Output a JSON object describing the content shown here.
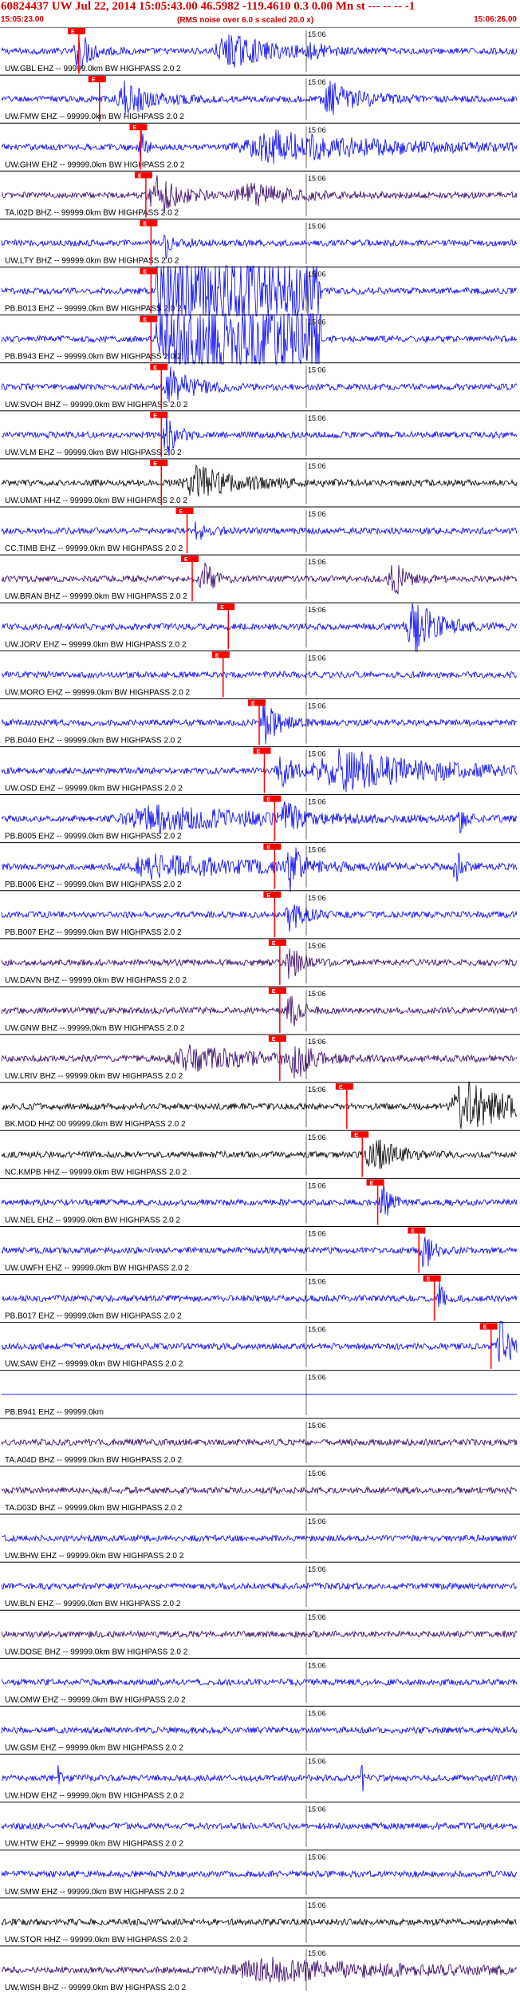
{
  "header": {
    "title": "60824437 UW Jul 22, 2014 15:05:43.00   46.5982 -119.4610  0.3 0.00 Mn st --- -- --   -1",
    "start_time": "15:05:23.00",
    "rms_note": "(RMS noise over 6.0 s scaled 20.0 x)",
    "end_time": "15:06:26.00"
  },
  "chart_data": {
    "type": "line",
    "title": "60824437 UW Jul 22, 2014 15:05:43.00   46.5982 -119.4610  0.3 0.00 Mn st --- -- --   -1",
    "subtitle": "(RMS noise over 6.0 s scaled 20.0 x)",
    "x_range": [
      "15:05:23.00",
      "15:06:26.00"
    ],
    "x_tick_label": "15:06",
    "colors": {
      "blue": "#0000ff",
      "black": "#000000",
      "purple": "#330066",
      "pick": "#ff0000",
      "grid": "#000000"
    },
    "traces": [
      {
        "label": "UW.GBL EHZ -- 99999.0km BW  HIGHPASS  2.0  2",
        "color": "blue",
        "pick": "E",
        "pick_frac": 0.15,
        "events": [
          {
            "at": 0.15,
            "w": 0.03,
            "a": 0.75
          },
          {
            "at": 0.44,
            "w": 0.1,
            "a": 0.6
          },
          {
            "at": 0.6,
            "w": 0.02,
            "a": 0.45
          }
        ]
      },
      {
        "label": "UW.FMW EHZ -- 99999.0km BW  HIGHPASS  2.0  2",
        "color": "blue",
        "pick": "E",
        "pick_frac": 0.19,
        "events": [
          {
            "at": 0.24,
            "w": 0.06,
            "a": 0.6
          },
          {
            "at": 0.64,
            "w": 0.07,
            "a": 0.6
          }
        ]
      },
      {
        "label": "UW.GHW EHZ -- 99999.0km BW  HIGHPASS  2.0  2",
        "color": "blue",
        "pick": "E",
        "pick_frac": 0.27,
        "events": [
          {
            "at": 0.27,
            "w": 0.01,
            "a": 0.9
          },
          {
            "at": 0.53,
            "w": 0.25,
            "a": 0.55
          }
        ]
      },
      {
        "label": "TA.I02D BHZ -- 99999.0km BW  HIGHPASS  2.0  2",
        "color": "purple",
        "pick": "E",
        "pick_frac": 0.28,
        "events": [
          {
            "at": 0.3,
            "w": 0.05,
            "a": 0.85
          },
          {
            "at": 0.48,
            "w": 0.1,
            "a": 0.4
          }
        ]
      },
      {
        "label": "UW.LTY BHZ -- 99999.0km BW  HIGHPASS  2.0  2",
        "color": "blue",
        "pick": "E",
        "pick_frac": 0.29,
        "events": [
          {
            "at": 0.32,
            "w": 0.03,
            "a": 0.5
          }
        ]
      },
      {
        "label": "PB.B013 EHZ -- 99999.0km BW  HIGHPASS  2.0  2",
        "color": "blue",
        "pick": "E",
        "pick_frac": 0.29,
        "saturate": [
          0.3,
          0.62
        ]
      },
      {
        "label": "PB.B943 EHZ -- 99999.0km BW  HIGHPASS  2.0  2",
        "color": "blue",
        "pick": "E",
        "pick_frac": 0.29,
        "saturate": [
          0.3,
          0.62
        ]
      },
      {
        "label": "UW.SVOH BHZ -- 99999.0km BW  HIGHPASS  2.0  2",
        "color": "blue",
        "pick": "E",
        "pick_frac": 0.31,
        "events": [
          {
            "at": 0.33,
            "w": 0.05,
            "a": 0.7
          }
        ]
      },
      {
        "label": "UW.VLM EHZ -- 99999.0km BW  HIGHPASS  2.0  2",
        "color": "blue",
        "pick": "E",
        "pick_frac": 0.31,
        "events": [
          {
            "at": 0.32,
            "w": 0.02,
            "a": 0.95
          }
        ]
      },
      {
        "label": "UW.UMAT HHZ -- 99999.0km BW  HIGHPASS  2.0  2",
        "color": "black",
        "pick": "E",
        "pick_frac": 0.31,
        "events": [
          {
            "at": 0.38,
            "w": 0.1,
            "a": 0.6
          }
        ]
      },
      {
        "label": "CC.TIMB EHZ -- 99999.0km BW  HIGHPASS  2.0  2",
        "color": "blue",
        "pick": "E",
        "pick_frac": 0.36,
        "events": [
          {
            "at": 0.38,
            "w": 0.03,
            "a": 0.35
          }
        ]
      },
      {
        "label": "UW.BRAN BHZ -- 99999.0km BW  HIGHPASS  2.0  2",
        "color": "purple",
        "pick": "E",
        "pick_frac": 0.37,
        "events": [
          {
            "at": 0.39,
            "w": 0.02,
            "a": 0.85
          },
          {
            "at": 0.76,
            "w": 0.03,
            "a": 0.7
          }
        ]
      },
      {
        "label": "UW.JORV EHZ -- 99999.0km BW  HIGHPASS  2.0  2",
        "color": "blue",
        "pick": "E",
        "pick_frac": 0.44,
        "events": [
          {
            "at": 0.8,
            "w": 0.06,
            "a": 1.0
          }
        ]
      },
      {
        "label": "UW.MORO EHZ -- 99999.0km BW  HIGHPASS  2.0  2",
        "color": "blue",
        "pick": "E",
        "pick_frac": 0.43,
        "events": []
      },
      {
        "label": "PB.B040 EHZ -- 99999.0km BW  HIGHPASS  2.0  2",
        "color": "blue",
        "pick": "E",
        "pick_frac": 0.5,
        "events": [
          {
            "at": 0.51,
            "w": 0.03,
            "a": 0.9
          }
        ]
      },
      {
        "label": "UW.OSD EHZ -- 99999.0km BW  HIGHPASS  2.0  2",
        "color": "blue",
        "pick": "E",
        "pick_frac": 0.51,
        "events": [
          {
            "at": 0.54,
            "w": 0.03,
            "a": 0.7
          },
          {
            "at": 0.66,
            "w": 0.2,
            "a": 0.8
          }
        ]
      },
      {
        "label": "PB.B005 EHZ -- 99999.0km BW  HIGHPASS  2.0  2",
        "color": "blue",
        "pick": "E",
        "pick_frac": 0.53,
        "events": [
          {
            "at": 0.55,
            "w": 0.02,
            "a": 0.95
          },
          {
            "at": 0.3,
            "w": 0.25,
            "a": 0.45
          },
          {
            "at": 0.89,
            "w": 0.01,
            "a": 0.9
          }
        ]
      },
      {
        "label": "PB.B006 EHZ -- 99999.0km BW  HIGHPASS  2.0  2",
        "color": "blue",
        "pick": "E",
        "pick_frac": 0.53,
        "events": [
          {
            "at": 0.56,
            "w": 0.02,
            "a": 1.0
          },
          {
            "at": 0.3,
            "w": 0.25,
            "a": 0.4
          },
          {
            "at": 0.88,
            "w": 0.01,
            "a": 0.95
          }
        ]
      },
      {
        "label": "PB.B007 EHZ -- 99999.0km BW  HIGHPASS  2.0  2",
        "color": "blue",
        "pick": "E",
        "pick_frac": 0.53,
        "events": [
          {
            "at": 0.56,
            "w": 0.03,
            "a": 0.7
          }
        ]
      },
      {
        "label": "UW.DAVN BHZ -- 99999.0km BW  HIGHPASS  2.0  2",
        "color": "purple",
        "pick": "E",
        "pick_frac": 0.54,
        "events": [
          {
            "at": 0.56,
            "w": 0.03,
            "a": 0.6
          }
        ]
      },
      {
        "label": "UW.GNW BHZ -- 99999.0km BW  HIGHPASS  2.0  2",
        "color": "purple",
        "pick": "E",
        "pick_frac": 0.54,
        "events": [
          {
            "at": 0.56,
            "w": 0.02,
            "a": 0.8
          }
        ]
      },
      {
        "label": "UW.LRIV BHZ -- 99999.0km BW  HIGHPASS  2.0  2",
        "color": "purple",
        "pick": "E",
        "pick_frac": 0.54,
        "events": [
          {
            "at": 0.57,
            "w": 0.03,
            "a": 0.8
          },
          {
            "at": 0.37,
            "w": 0.15,
            "a": 0.45
          }
        ]
      },
      {
        "label": "BK.MOD HHZ 00 99999.0km BW  HIGHPASS  2.0  2",
        "color": "black",
        "pick": "E",
        "pick_frac": 0.67,
        "events": [
          {
            "at": 0.9,
            "w": 0.1,
            "a": 1.0
          }
        ]
      },
      {
        "label": "NC.KMPB HHZ -- 99999.0km BW  HIGHPASS  2.0  2",
        "color": "black",
        "pick": "E",
        "pick_frac": 0.7,
        "events": [
          {
            "at": 0.72,
            "w": 0.05,
            "a": 0.7
          }
        ]
      },
      {
        "label": "UW.NEL EHZ -- 99999.0km BW  HIGHPASS  2.0  2",
        "color": "blue",
        "pick": "E",
        "pick_frac": 0.73,
        "events": [
          {
            "at": 0.74,
            "w": 0.02,
            "a": 0.7
          }
        ]
      },
      {
        "label": "UW.UWFH EHZ -- 99999.0km BW  HIGHPASS  2.0  2",
        "color": "blue",
        "pick": "E",
        "pick_frac": 0.81,
        "events": [
          {
            "at": 0.82,
            "w": 0.02,
            "a": 0.8
          }
        ]
      },
      {
        "label": "PB.B017 EHZ -- 99999.0km BW  HIGHPASS  2.0  2",
        "color": "blue",
        "pick": "E",
        "pick_frac": 0.84,
        "events": [
          {
            "at": 0.85,
            "w": 0.01,
            "a": 0.6
          }
        ]
      },
      {
        "label": "UW.SAW EHZ -- 99999.0km BW  HIGHPASS  2.0  2",
        "color": "blue",
        "pick": "E",
        "pick_frac": 0.95,
        "events": [
          {
            "at": 0.97,
            "w": 0.03,
            "a": 1.0
          }
        ]
      },
      {
        "label": "PB.B941 EHZ -- 99999.0km",
        "color": "blue",
        "flat": true
      },
      {
        "label": "TA.A04D BHZ -- 99999.0km BW  HIGHPASS  2.0  2",
        "color": "purple",
        "events": []
      },
      {
        "label": "TA.D03D BHZ -- 99999.0km BW  HIGHPASS  2.0  2",
        "color": "purple",
        "events": []
      },
      {
        "label": "UW.BHW EHZ -- 99999.0km BW  HIGHPASS  2.0  2",
        "color": "blue",
        "events": []
      },
      {
        "label": "UW.BLN EHZ -- 99999.0km BW  HIGHPASS  2.0  2",
        "color": "blue",
        "events": []
      },
      {
        "label": "UW.DOSE BHZ -- 99999.0km BW  HIGHPASS  2.0  2",
        "color": "purple",
        "events": []
      },
      {
        "label": "UW.OMW EHZ -- 99999.0km BW  HIGHPASS  2.0  2",
        "color": "blue",
        "events": []
      },
      {
        "label": "UW.GSM EHZ -- 99999.0km BW  HIGHPASS  2.0  2",
        "color": "blue",
        "events": []
      },
      {
        "label": "UW.HDW EHZ -- 99999.0km BW  HIGHPASS  2.0  2",
        "color": "blue",
        "events": [
          {
            "at": 0.11,
            "w": 0.005,
            "a": 0.5
          },
          {
            "at": 0.7,
            "w": 0.005,
            "a": 0.7
          }
        ]
      },
      {
        "label": "UW.HTW EHZ -- 99999.0km BW  HIGHPASS  2.0  2",
        "color": "blue",
        "events": []
      },
      {
        "label": "UW.SMW EHZ -- 99999.0km BW  HIGHPASS  2.0  2",
        "color": "blue",
        "events": []
      },
      {
        "label": "UW.STOR HHZ -- 99999.0km BW  HIGHPASS  2.0  2",
        "color": "black",
        "events": []
      },
      {
        "label": "UW.WISH BHZ -- 99999.0km BW  HIGHPASS  2.0  2",
        "color": "purple",
        "events": [
          {
            "at": 0.52,
            "w": 0.3,
            "a": 0.4
          }
        ]
      }
    ]
  }
}
